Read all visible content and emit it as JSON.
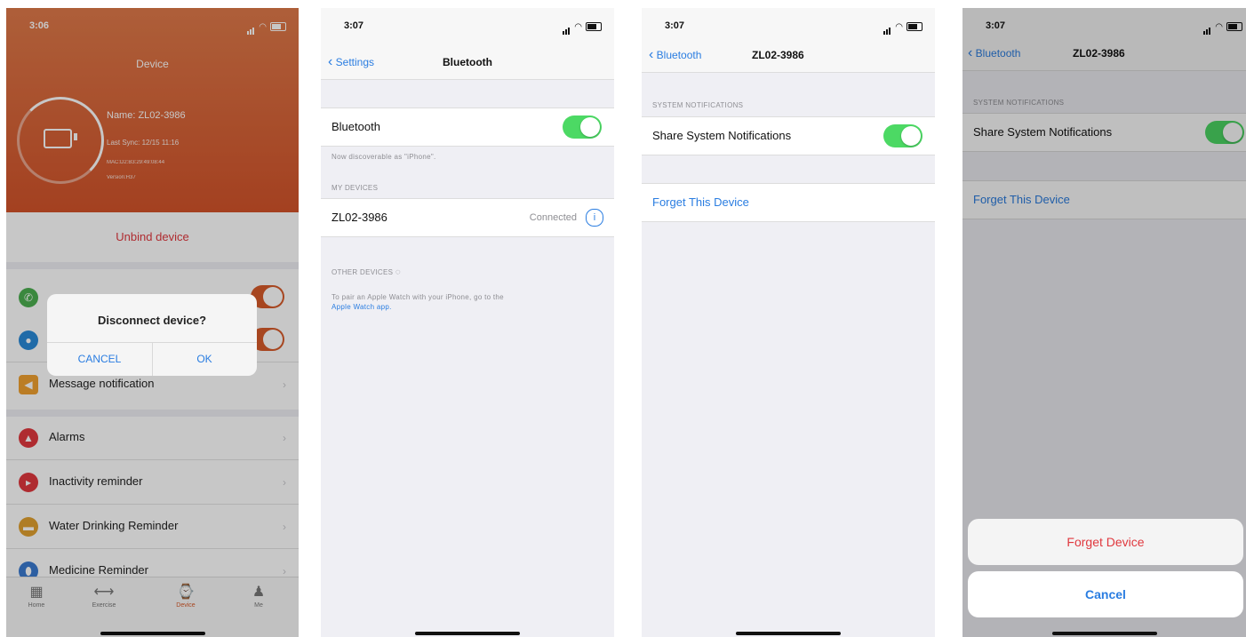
{
  "colors": {
    "orange": "#d65a2a",
    "toggle_green": "#4cd964",
    "link_blue": "#2a7de1",
    "danger_red": "#e0383e"
  },
  "screen1": {
    "status_time": "3:06",
    "header_title": "Device",
    "device_name": "Name: ZL02-3986",
    "last_sync": "Last Sync: 12/15 11:16",
    "mac": "MAC:D2:B3:29:49:08:44",
    "version": "Version:H37",
    "unbind_label": "Unbind device",
    "rows": [
      {
        "label": "Message notification",
        "icon": "speaker-icon",
        "color": "#f0a030"
      },
      {
        "label": "Alarms",
        "icon": "bell-icon",
        "color": "#e0383e"
      },
      {
        "label": "Inactivity reminder",
        "icon": "clock-icon",
        "color": "#e0383e"
      },
      {
        "label": "Water Drinking Reminder",
        "icon": "cup-icon",
        "color": "#e0a030"
      },
      {
        "label": "Medicine Reminder",
        "icon": "pill-icon",
        "color": "#3a7ad0"
      }
    ],
    "dialog": {
      "title": "Disconnect device?",
      "cancel": "CANCEL",
      "ok": "OK"
    },
    "tabs": [
      "Home",
      "Exercise",
      "Device",
      "Me"
    ]
  },
  "screen2": {
    "status_time": "3:07",
    "back_label": "Settings",
    "nav_title": "Bluetooth",
    "bluetooth_label": "Bluetooth",
    "discoverable": "Now discoverable as \"iPhone\".",
    "my_devices_header": "MY DEVICES",
    "device_name": "ZL02-3986",
    "device_status": "Connected",
    "other_devices_header": "OTHER DEVICES",
    "pair_text": "To pair an Apple Watch with your iPhone, go to the",
    "pair_link": "Apple Watch app."
  },
  "screen3": {
    "status_time": "3:07",
    "back_label": "Bluetooth",
    "nav_title": "ZL02-3986",
    "system_header": "SYSTEM NOTIFICATIONS",
    "share_label": "Share System Notifications",
    "forget_label": "Forget This Device"
  },
  "screen4": {
    "status_time": "3:07",
    "back_label": "Bluetooth",
    "nav_title": "ZL02-3986",
    "system_header": "SYSTEM NOTIFICATIONS",
    "share_label": "Share System Notifications",
    "forget_label": "Forget This Device",
    "action_forget": "Forget Device",
    "action_cancel": "Cancel"
  }
}
